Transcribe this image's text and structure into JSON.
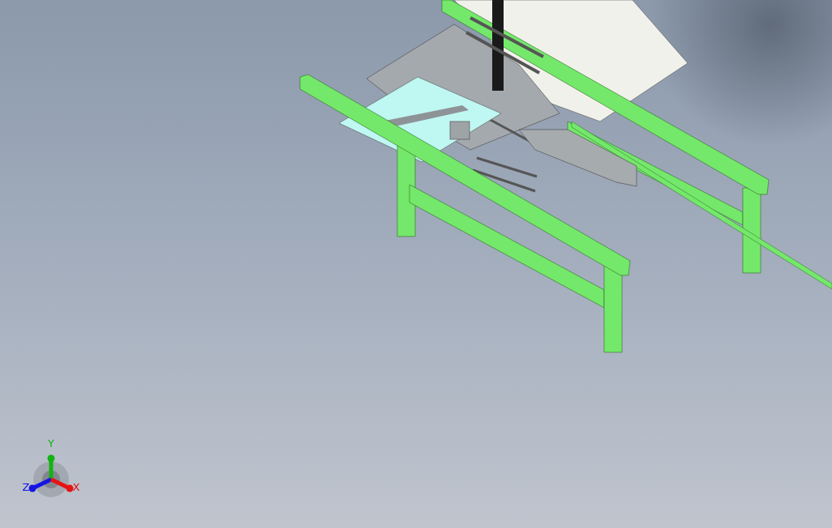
{
  "viewport": {
    "triad": {
      "axes": [
        {
          "label": "Y",
          "color": "#12b312"
        },
        {
          "label": "Z",
          "color": "#1414e6"
        },
        {
          "label": "X",
          "color": "#e61414"
        }
      ]
    }
  }
}
